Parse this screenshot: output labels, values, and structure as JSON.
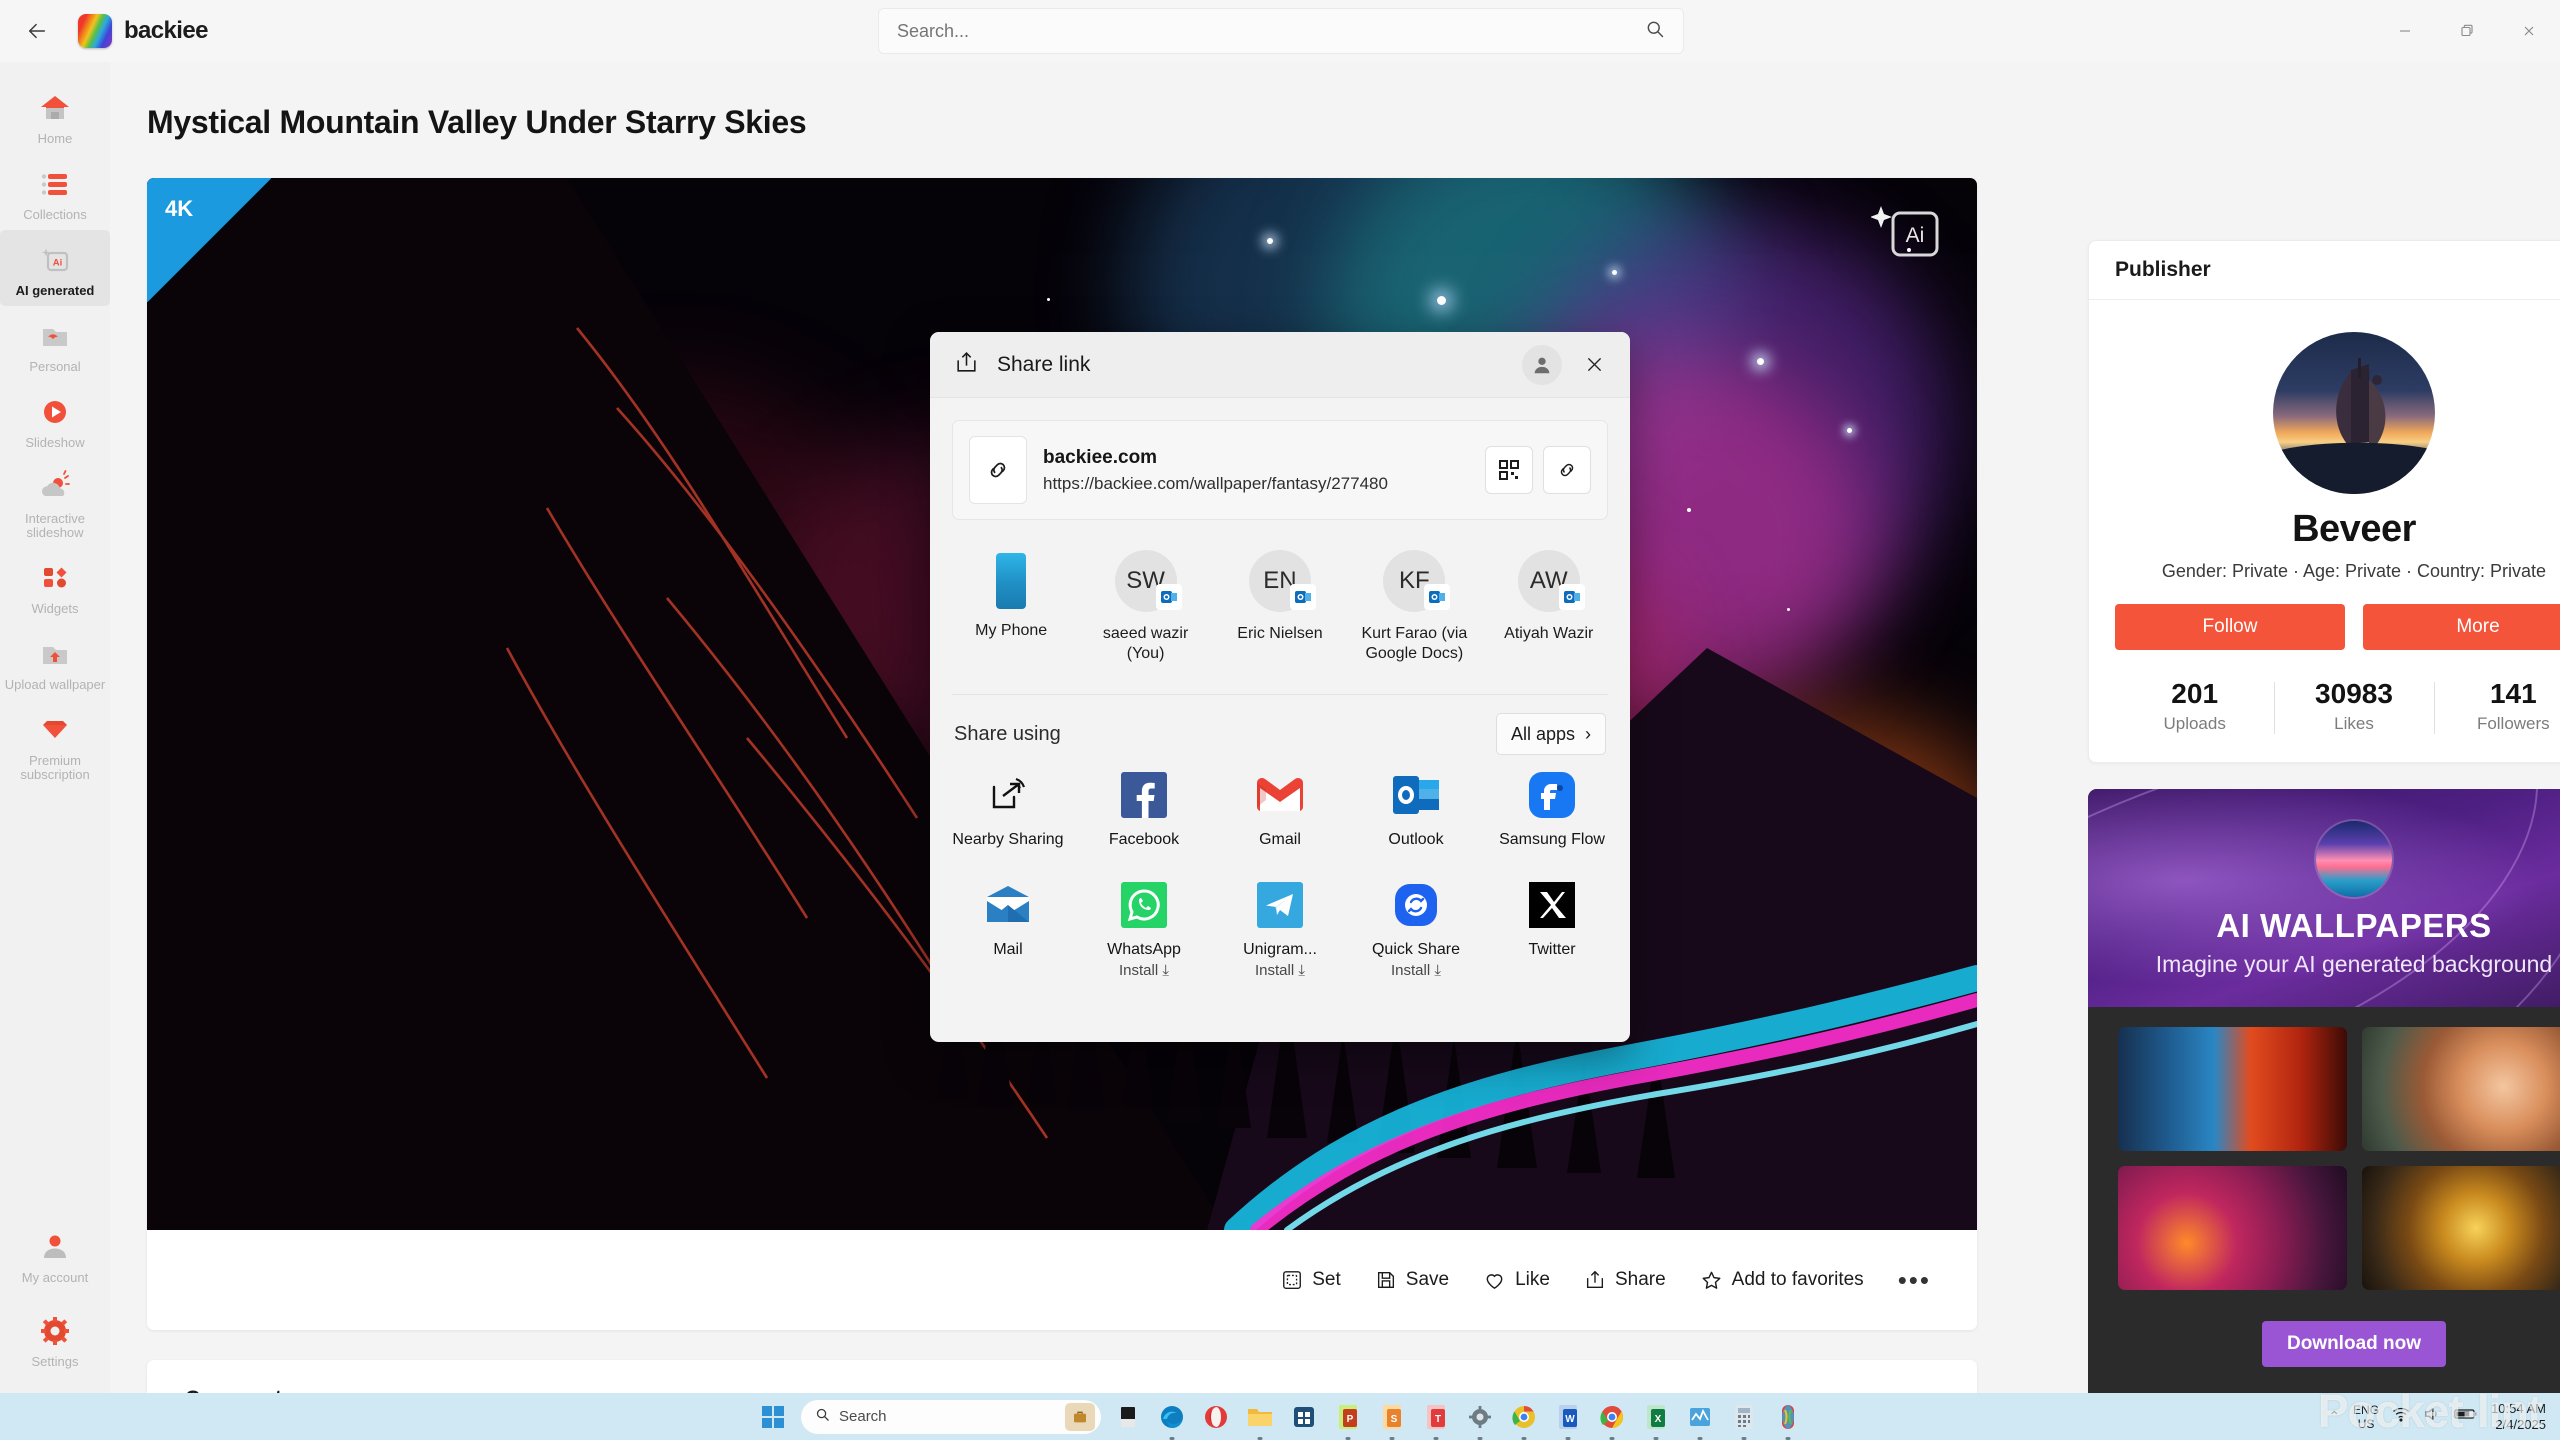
{
  "window": {
    "brand": "backiee",
    "back_icon": "back-arrow-icon",
    "search_placeholder": "Search...",
    "controls": {
      "minimize": "–",
      "maximize": "❐",
      "close": "✕"
    }
  },
  "sidebar": {
    "items": [
      {
        "label": "Home",
        "icon": "home-icon",
        "active": false
      },
      {
        "label": "Collections",
        "icon": "collections-icon",
        "active": false
      },
      {
        "label": "AI generated",
        "icon": "ai-generated-icon",
        "active": true
      },
      {
        "label": "Personal",
        "icon": "personal-folder-icon",
        "active": false
      },
      {
        "label": "Slideshow",
        "icon": "slideshow-play-icon",
        "active": false
      },
      {
        "label": "Interactive slideshow",
        "icon": "interactive-slideshow-icon",
        "active": false
      },
      {
        "label": "Widgets",
        "icon": "widgets-icon",
        "active": false
      },
      {
        "label": "Upload wallpaper",
        "icon": "upload-wallpaper-icon",
        "active": false
      },
      {
        "label": "Premium subscription",
        "icon": "premium-diamond-icon",
        "active": false
      }
    ],
    "bottom_items": [
      {
        "label": "My account",
        "icon": "my-account-icon"
      },
      {
        "label": "Settings",
        "icon": "settings-gear-icon"
      }
    ]
  },
  "main": {
    "page_title": "Mystical Mountain Valley Under Starry Skies",
    "resolution_badge": "4K",
    "ai_badge": "Ai",
    "actions": [
      {
        "label": "Set",
        "icon": "set-wallpaper-icon"
      },
      {
        "label": "Save",
        "icon": "save-disk-icon"
      },
      {
        "label": "Like",
        "icon": "heart-icon"
      },
      {
        "label": "Share",
        "icon": "share-icon"
      },
      {
        "label": "Add to favorites",
        "icon": "star-icon"
      }
    ],
    "more_label": "•••",
    "comments": {
      "title": "Comments",
      "chevron": "⌄"
    }
  },
  "publisher": {
    "header": "Publisher",
    "name": "Beveer",
    "meta": "Gender: Private · Age: Private · Country: Private",
    "follow_label": "Follow",
    "more_label": "More",
    "accent_color": "#f4543a",
    "stats": [
      {
        "value": "201",
        "label": "Uploads"
      },
      {
        "value": "30983",
        "label": "Likes"
      },
      {
        "value": "141",
        "label": "Followers"
      }
    ]
  },
  "ad": {
    "title": "AI WALLPAPERS",
    "subtitle": "Imagine your AI generated background",
    "cta": "Download now",
    "cta_color": "#9a55d4",
    "thumbs": [
      "anime-duel-thumb",
      "red-haired-girl-thumb",
      "burning-blossom-tree-thumb",
      "golden-armored-soldier-thumb"
    ]
  },
  "share_dialog": {
    "title": "Share link",
    "title_icon": "share-icon",
    "account_icon": "person-icon",
    "close_icon": "close-icon",
    "link": {
      "domain": "backiee.com",
      "url": "https://backiee.com/wallpaper/fantasy/277480",
      "link_icon": "link-icon",
      "qr_label": "qr-code-icon",
      "copy_label": "copy-link-icon"
    },
    "contacts": [
      {
        "name": "My Phone",
        "initials": "",
        "icon": "phone-icon",
        "badge": ""
      },
      {
        "name": "saeed wazir (You)",
        "initials": "SW",
        "icon": "contact-avatar-icon",
        "badge": "outlook-badge-icon"
      },
      {
        "name": "Eric Nielsen",
        "initials": "EN",
        "icon": "contact-avatar-icon",
        "badge": "outlook-badge-icon"
      },
      {
        "name": "Kurt Farao (via Google Docs)",
        "initials": "KF",
        "icon": "contact-avatar-icon",
        "badge": "outlook-badge-icon"
      },
      {
        "name": "Atiyah Wazir",
        "initials": "AW",
        "icon": "contact-avatar-icon",
        "badge": "outlook-badge-icon"
      }
    ],
    "share_using_label": "Share using",
    "all_apps_label": "All apps",
    "all_apps_chevron": "›",
    "apps_row1": [
      {
        "name": "Nearby Sharing",
        "icon": "nearby-sharing-icon",
        "install": ""
      },
      {
        "name": "Facebook",
        "icon": "facebook-icon",
        "install": ""
      },
      {
        "name": "Gmail",
        "icon": "gmail-icon",
        "install": ""
      },
      {
        "name": "Outlook",
        "icon": "outlook-icon",
        "install": ""
      },
      {
        "name": "Samsung Flow",
        "icon": "samsung-flow-icon",
        "install": ""
      }
    ],
    "apps_row2": [
      {
        "name": "Mail",
        "icon": "mail-icon",
        "install": ""
      },
      {
        "name": "WhatsApp",
        "icon": "whatsapp-icon",
        "install": "Install ⤓"
      },
      {
        "name": "Unigram...",
        "icon": "telegram-unigram-icon",
        "install": "Install ⤓"
      },
      {
        "name": "Quick Share",
        "icon": "quick-share-icon",
        "install": "Install ⤓"
      },
      {
        "name": "Twitter",
        "icon": "twitter-x-icon",
        "install": ""
      }
    ]
  },
  "taskbar": {
    "start_icon": "windows-start-icon",
    "search_label": "Search",
    "search_icon": "search-icon",
    "bag_icon": "briefcase-icon",
    "apps": [
      "dark-app-icon",
      "edge-icon",
      "opera-icon",
      "file-explorer-icon",
      "microsoft-store-icon",
      "powerpoint-icon",
      "samsung-notes-icon",
      "teams-icon",
      "settings-gear-icon",
      "chrome-canary-icon",
      "word-icon",
      "chrome-icon",
      "excel-icon",
      "task-manager-icon",
      "calculator-icon",
      "backiee-icon"
    ],
    "language": {
      "line1": "ENG",
      "line2": "US"
    },
    "tray_icons": [
      "wifi-icon",
      "volume-icon",
      "battery-icon"
    ],
    "chevron": "⌃",
    "time": "10:54 AM",
    "date": "2/4/2025"
  },
  "watermark": {
    "text": "Pocket-lint"
  }
}
